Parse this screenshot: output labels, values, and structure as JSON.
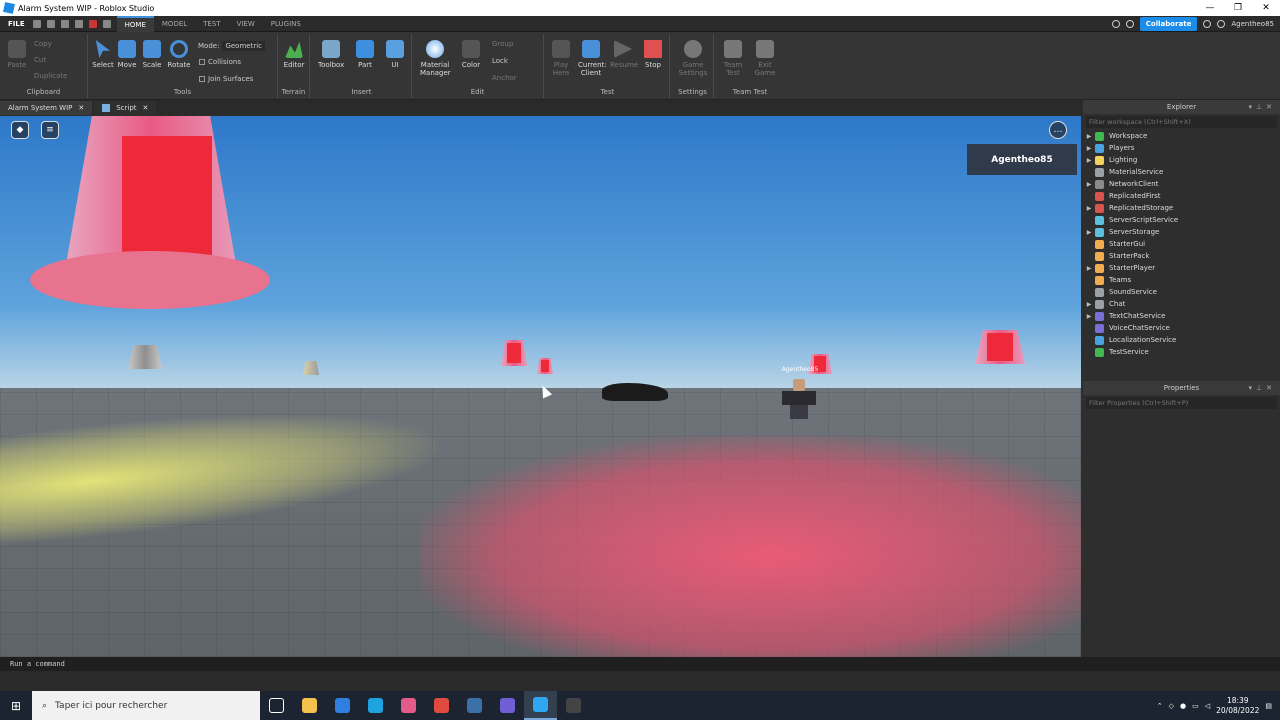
{
  "window": {
    "title": "Alarm System WIP - Roblox Studio",
    "controls": [
      "—",
      "❐",
      "✕"
    ]
  },
  "menubar": {
    "file": "FILE",
    "tabs": [
      "HOME",
      "MODEL",
      "TEST",
      "VIEW",
      "PLUGINS"
    ],
    "active_tab": "HOME",
    "collaborate": "Collaborate",
    "username": "Agentheo85"
  },
  "ribbon": {
    "clipboard": {
      "paste": "Paste",
      "copy": "Copy",
      "cut": "Cut",
      "duplicate": "Duplicate",
      "group": "Clipboard"
    },
    "tools": {
      "select": "Select",
      "move": "Move",
      "scale": "Scale",
      "rotate": "Rotate",
      "mode_label": "Mode:",
      "mode_value": "Geometric",
      "collisions": "Collisions",
      "join_surfaces": "Join Surfaces",
      "group": "Tools"
    },
    "terrain": {
      "editor": "Editor",
      "group": "Terrain"
    },
    "insert": {
      "toolbox": "Toolbox",
      "part": "Part",
      "ui": "UI",
      "group": "Insert"
    },
    "edit": {
      "material": "Material",
      "material2": "Manager",
      "color": "Color",
      "group_btn": "Group",
      "lock": "Lock",
      "anchor": "Anchor",
      "group": "Edit"
    },
    "test": {
      "play": "Play",
      "play2": "Here",
      "current": "Current:",
      "client": "Client",
      "resume": "Resume",
      "stop": "Stop",
      "group": "Test"
    },
    "settings": {
      "game": "Game",
      "game2": "Settings",
      "group": "Settings"
    },
    "team_test": {
      "team": "Team",
      "team2": "Test",
      "exit": "Exit",
      "exit2": "Game",
      "group": "Team Test"
    }
  },
  "doc_tabs": [
    {
      "label": "Alarm System WIP"
    },
    {
      "label": "Script"
    }
  ],
  "viewport": {
    "player_name": "Agentheo85",
    "avatar_tag": "Agentheo85"
  },
  "explorer": {
    "title": "Explorer",
    "filter": "Filter workspace (Ctrl+Shift+X)",
    "items": [
      {
        "label": "Workspace",
        "color": "#3fb950",
        "expandable": true
      },
      {
        "label": "Players",
        "color": "#4aa3df",
        "expandable": true
      },
      {
        "label": "Lighting",
        "color": "#f2d45c",
        "expandable": true
      },
      {
        "label": "MaterialService",
        "color": "#9aa0a6",
        "expandable": false
      },
      {
        "label": "NetworkClient",
        "color": "#8b8b8b",
        "expandable": true
      },
      {
        "label": "ReplicatedFirst",
        "color": "#d9534f",
        "expandable": false
      },
      {
        "label": "ReplicatedStorage",
        "color": "#d9534f",
        "expandable": true
      },
      {
        "label": "ServerScriptService",
        "color": "#5bc0de",
        "expandable": false
      },
      {
        "label": "ServerStorage",
        "color": "#5bc0de",
        "expandable": true
      },
      {
        "label": "StarterGui",
        "color": "#f0ad4e",
        "expandable": false
      },
      {
        "label": "StarterPack",
        "color": "#f0ad4e",
        "expandable": false
      },
      {
        "label": "StarterPlayer",
        "color": "#f0ad4e",
        "expandable": true
      },
      {
        "label": "Teams",
        "color": "#f0ad4e",
        "expandable": false
      },
      {
        "label": "SoundService",
        "color": "#9aa0a6",
        "expandable": false
      },
      {
        "label": "Chat",
        "color": "#9aa0a6",
        "expandable": true
      },
      {
        "label": "TextChatService",
        "color": "#7a6fd6",
        "expandable": true
      },
      {
        "label": "VoiceChatService",
        "color": "#7a6fd6",
        "expandable": false
      },
      {
        "label": "LocalizationService",
        "color": "#4aa3df",
        "expandable": false
      },
      {
        "label": "TestService",
        "color": "#3fb950",
        "expandable": false
      }
    ]
  },
  "properties": {
    "title": "Properties",
    "filter": "Filter Properties (Ctrl+Shift+P)"
  },
  "command_bar": {
    "placeholder": "Run a command"
  },
  "taskbar": {
    "search_placeholder": "Taper ici pour rechercher",
    "apps": [
      {
        "icon": "task-view-icon",
        "color": "#1b2430"
      },
      {
        "icon": "file-explorer-icon",
        "color": "#f2c14e"
      },
      {
        "icon": "store-icon",
        "color": "#2f7fe0"
      },
      {
        "icon": "edge-icon",
        "color": "#1fa3e0"
      },
      {
        "icon": "app-icon",
        "color": "#e25c8a"
      },
      {
        "icon": "chrome-icon",
        "color": "#e04a3f"
      },
      {
        "icon": "steam-icon",
        "color": "#3d6fa8"
      },
      {
        "icon": "discord-icon",
        "color": "#6f5ed6"
      },
      {
        "icon": "roblox-studio-icon",
        "color": "#2ea6f2"
      },
      {
        "icon": "obs-icon",
        "color": "#444"
      }
    ],
    "time": "18:39",
    "date": "20/08/2022"
  }
}
